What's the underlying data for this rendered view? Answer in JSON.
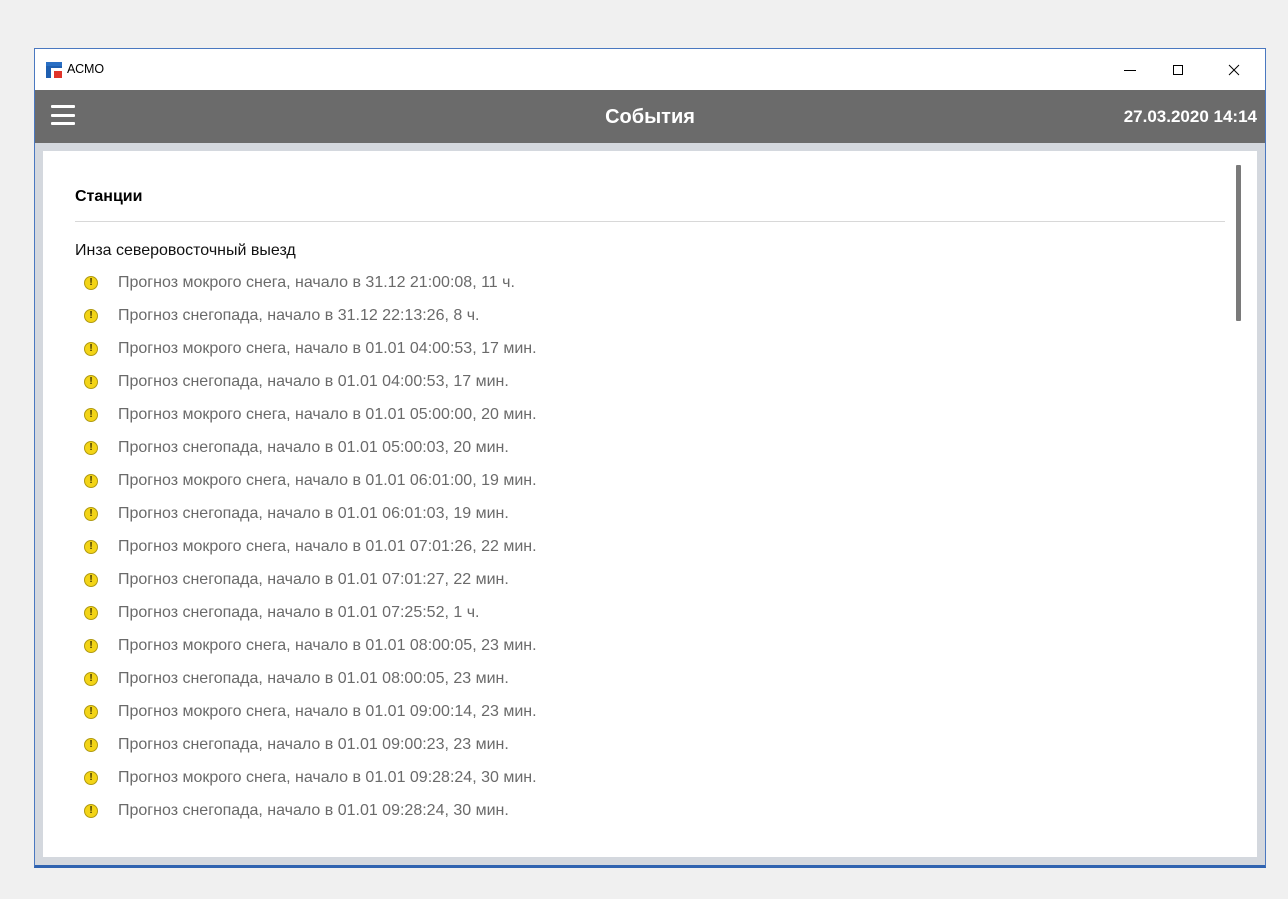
{
  "window": {
    "title": "АСМО"
  },
  "appbar": {
    "title": "События",
    "datetime": "27.03.2020 14:14"
  },
  "section": {
    "title": "Станции"
  },
  "station": {
    "name": "Инза северовосточный выезд",
    "events": [
      "Прогноз мокрого снега, начало в 31.12 21:00:08, 11 ч.",
      "Прогноз снегопада, начало в 31.12 22:13:26, 8 ч.",
      "Прогноз мокрого снега, начало в 01.01 04:00:53, 17 мин.",
      "Прогноз снегопада, начало в 01.01 04:00:53, 17 мин.",
      "Прогноз мокрого снега, начало в 01.01 05:00:00, 20 мин.",
      "Прогноз снегопада, начало в 01.01 05:00:03, 20 мин.",
      "Прогноз мокрого снега, начало в 01.01 06:01:00, 19 мин.",
      "Прогноз снегопада, начало в 01.01 06:01:03, 19 мин.",
      "Прогноз мокрого снега, начало в 01.01 07:01:26, 22 мин.",
      "Прогноз снегопада, начало в 01.01 07:01:27, 22 мин.",
      "Прогноз снегопада, начало в 01.01 07:25:52, 1 ч.",
      "Прогноз мокрого снега, начало в 01.01 08:00:05, 23 мин.",
      "Прогноз снегопада, начало в 01.01 08:00:05, 23 мин.",
      "Прогноз мокрого снега, начало в 01.01 09:00:14, 23 мин.",
      "Прогноз снегопада, начало в 01.01 09:00:23, 23 мин.",
      "Прогноз мокрого снега, начало в 01.01 09:28:24, 30 мин.",
      "Прогноз снегопада, начало в 01.01 09:28:24, 30 мин."
    ]
  },
  "icons": {
    "event": "warning-icon",
    "menu": "hamburger-menu-icon",
    "app": "app-logo-icon"
  },
  "colors": {
    "appbar": "#6b6b6b",
    "warning": "#f3d417",
    "window_border": "#2f63b0"
  }
}
